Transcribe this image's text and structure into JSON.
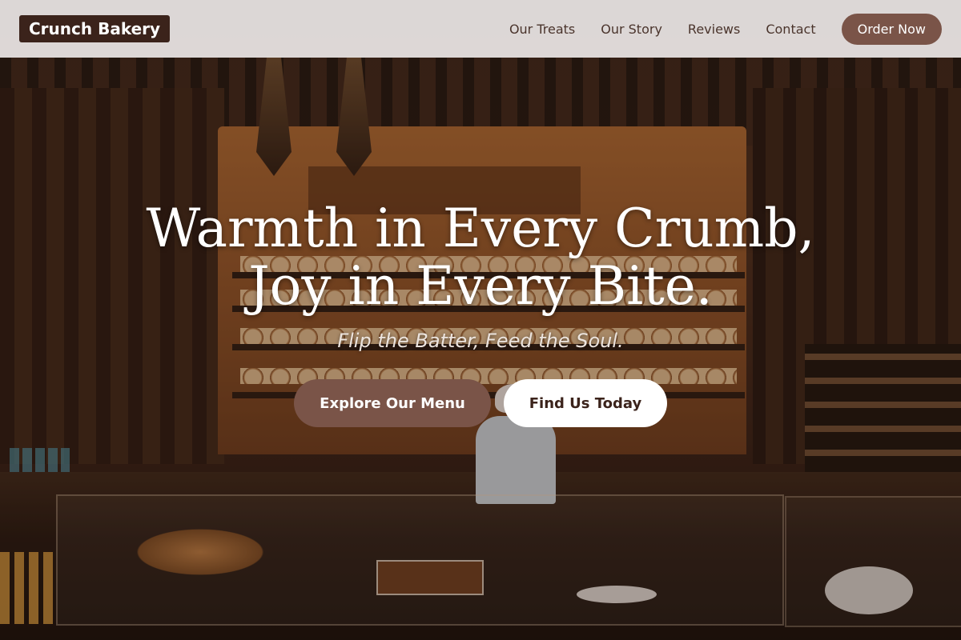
{
  "brand": {
    "name": "Crunch Bakery"
  },
  "nav": {
    "items": [
      {
        "label": "Our Treats"
      },
      {
        "label": "Our Story"
      },
      {
        "label": "Reviews"
      },
      {
        "label": "Contact"
      }
    ],
    "cta_label": "Order Now"
  },
  "hero": {
    "title_line1": "Warmth in Every Crumb,",
    "title_line2": "Joy in Every Bite.",
    "tagline": "Flip the Batter, Feed the Soul.",
    "primary_button": "Explore Our Menu",
    "secondary_button": "Find Us Today"
  },
  "colors": {
    "accent": "#7a5448",
    "brand_bg": "#3b231b",
    "header_bg": "#e6e2e0"
  }
}
